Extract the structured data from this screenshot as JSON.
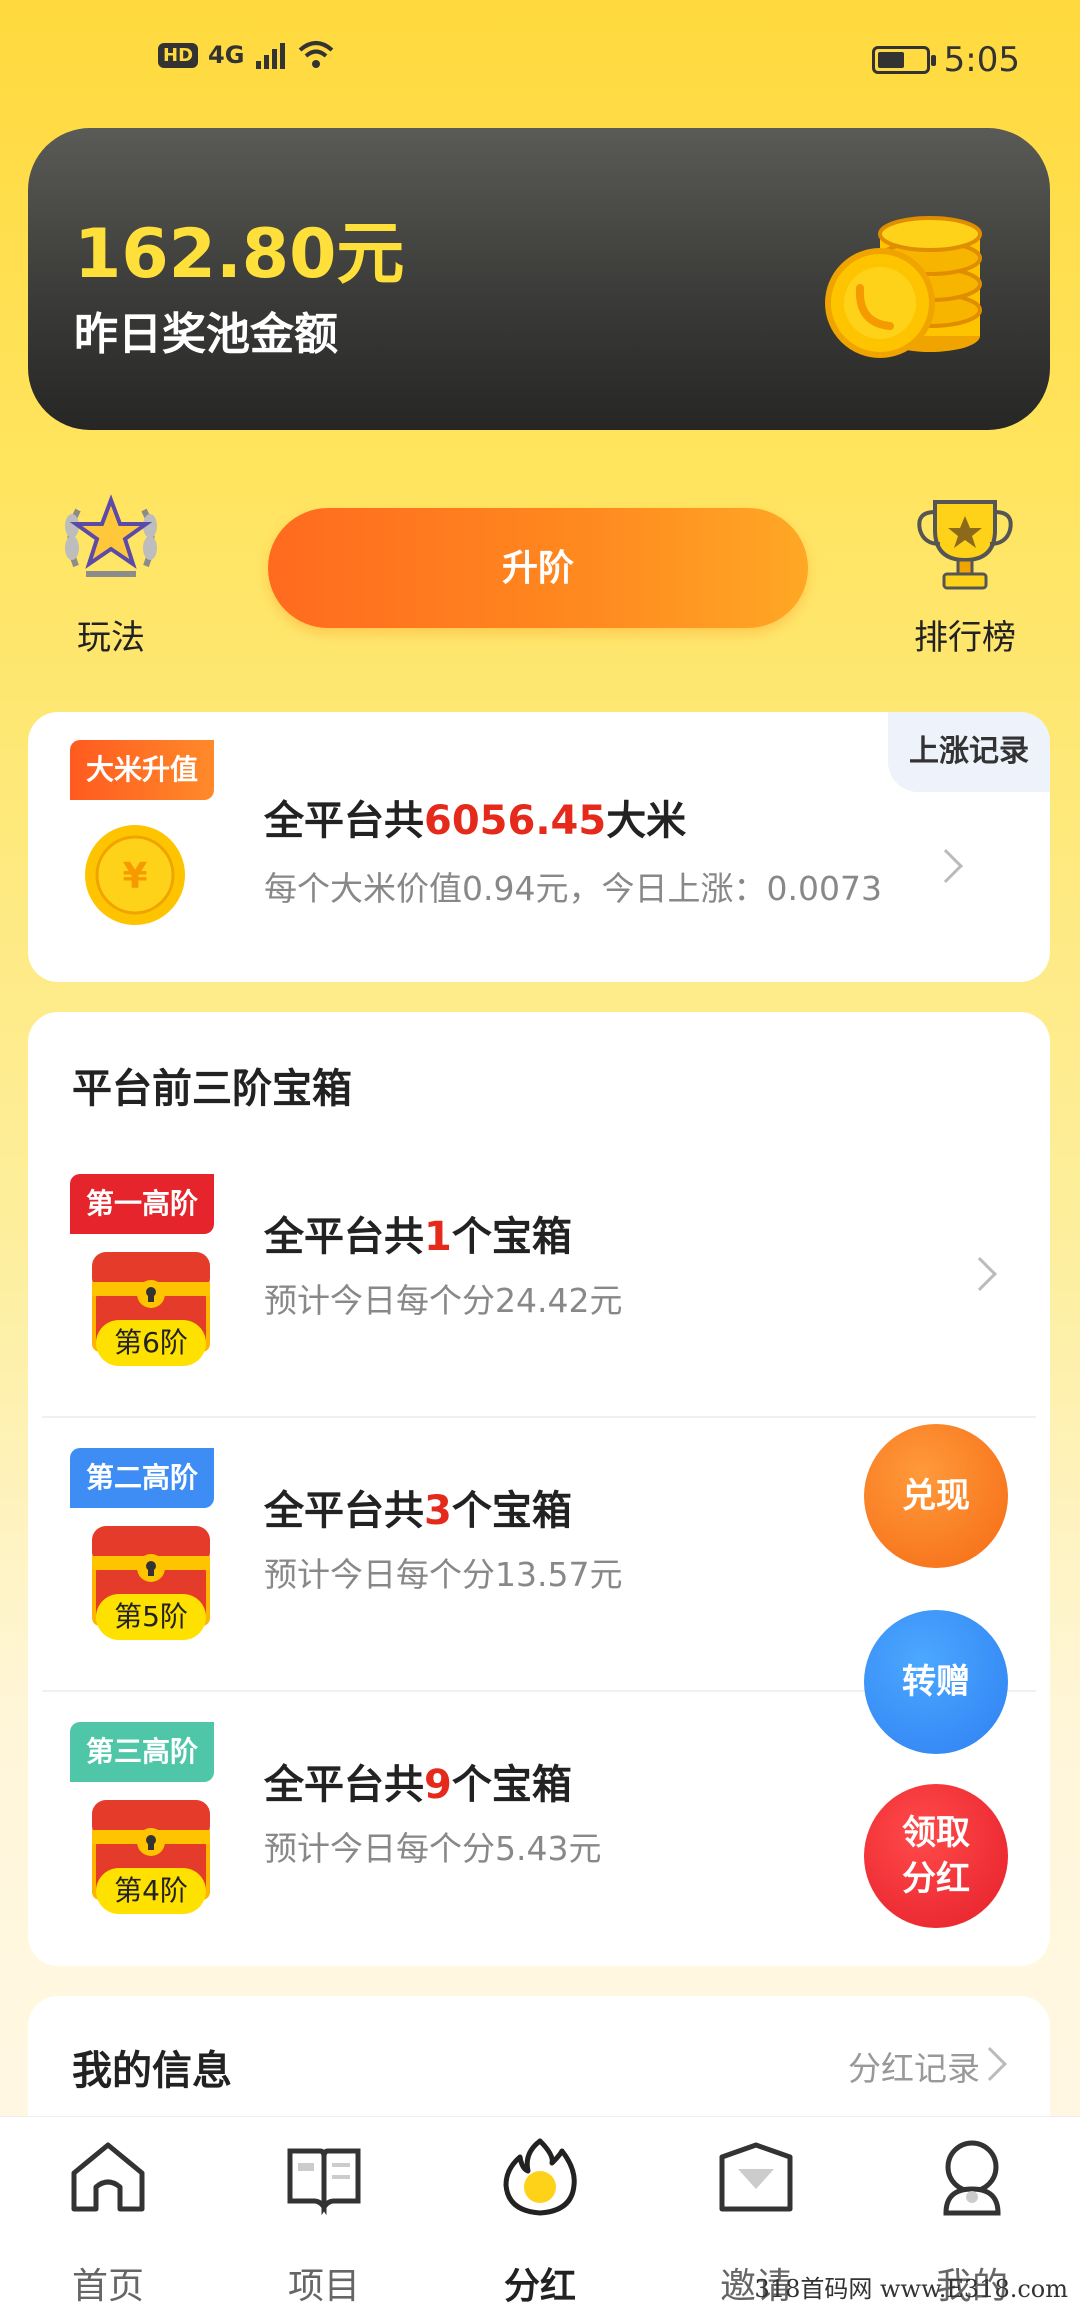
{
  "status_bar": {
    "hd": "HD",
    "network": "4G",
    "time": "5:05"
  },
  "pool": {
    "amount": "162.80元",
    "label": "昨日奖池金额"
  },
  "actions": {
    "play_label": "玩法",
    "upgrade_label": "升阶",
    "rank_label": "排行榜"
  },
  "rice": {
    "tag": "大米升值",
    "record_label": "上涨记录",
    "title_prefix": "全平台共",
    "title_amount": "6056.45",
    "title_suffix": "大米",
    "subtitle": "每个大米价值0.94元，今日上涨：0.0073"
  },
  "chests": {
    "title": "平台前三阶宝箱",
    "rows": [
      {
        "tag": "第一高阶",
        "tag_color": "#E5242B",
        "level": "第6阶",
        "title_prefix": "全平台共",
        "count": "1",
        "title_suffix": "个宝箱",
        "subtitle": "预计今日每个分24.42元"
      },
      {
        "tag": "第二高阶",
        "tag_color": "#3D8DF5",
        "level": "第5阶",
        "title_prefix": "全平台共",
        "count": "3",
        "title_suffix": "个宝箱",
        "subtitle": "预计今日每个分13.57元"
      },
      {
        "tag": "第三高阶",
        "tag_color": "#4FC6A8",
        "level": "第4阶",
        "title_prefix": "全平台共",
        "count": "9",
        "title_suffix": "个宝箱",
        "subtitle": "预计今日每个分5.43元"
      }
    ]
  },
  "fabs": {
    "cash": "兑现",
    "transfer": "转赠",
    "claim_line1": "领取",
    "claim_line2": "分红"
  },
  "info": {
    "title": "我的信息",
    "link": "分红记录"
  },
  "tabs": [
    {
      "label": "首页",
      "icon": "home-icon"
    },
    {
      "label": "项目",
      "icon": "book-icon"
    },
    {
      "label": "分红",
      "icon": "flame-icon",
      "active": true
    },
    {
      "label": "邀请",
      "icon": "envelope-icon"
    },
    {
      "label": "我的",
      "icon": "user-icon"
    }
  ],
  "watermark": "318首码网 www.E318.com",
  "colors": {
    "accent": "#FFD93D",
    "primary_orange": "#FF6A1F",
    "highlight_red": "#E52A1C"
  }
}
